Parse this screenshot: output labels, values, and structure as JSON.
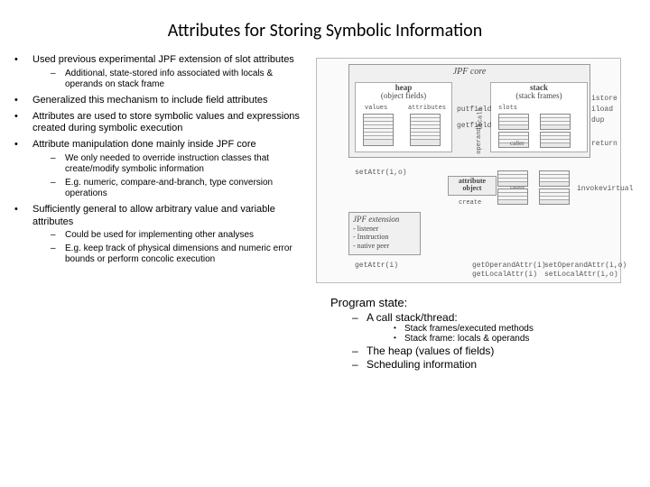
{
  "title": "Attributes for Storing Symbolic Information",
  "bullets": {
    "b1": "Used previous experimental JPF extension of slot attributes",
    "b1s1": "Additional, state-stored info associated with locals & operands on stack frame",
    "b2": "Generalized this mechanism to include field attributes",
    "b3": "Attributes are used to store symbolic values and expressions created during symbolic execution",
    "b4": "Attribute manipulation done mainly inside JPF core",
    "b4s1": "We only needed to override instruction classes that create/modify symbolic information",
    "b4s2": "E.g. numeric, compare-and-branch, type conversion operations",
    "b5": "Sufficiently general to allow arbitrary value and variable attributes",
    "b5s1": "Could be used for implementing other analyses",
    "b5s2": "E.g. keep track of physical dimensions and numeric error bounds or perform concolic execution"
  },
  "diagram": {
    "jpfcore": "JPF core",
    "heap_title": "heap",
    "heap_sub": "(object fields)",
    "stack_title": "stack",
    "stack_sub": "(stack frames)",
    "values": "values",
    "attributes": "attributes",
    "slots": "slots",
    "locals": "locals",
    "operands": "operands",
    "putfield": "putfield",
    "getfield": "getfield",
    "caller": "caller",
    "callee": "callee",
    "istore": "istore",
    "iload": "iload",
    "dup": "dup",
    "return": "return",
    "invokevirtual": "invokevirtual",
    "attr_obj1": "attribute",
    "attr_obj2": "object",
    "create": "create",
    "jpf_ext_head": "JPF extension",
    "jpf_ext1": "- listener",
    "jpf_ext2": "- Instruction",
    "jpf_ext3": "- native peer",
    "api_setAttr": "setAttr(i,o)",
    "api_getAttr": "getAttr(i)",
    "api_getOperandAttr": "getOperandAttr(i)",
    "api_getLocalAttr": "getLocalAttr(i)",
    "api_setOperandAttr": "setOperandAttr(i,o)",
    "api_setLocalAttr": "setLocalAttr(i,o)"
  },
  "program_state": {
    "title": "Program state:",
    "s1": "A call stack/thread:",
    "s1a": "Stack frames/executed methods",
    "s1b": "Stack frame: locals & operands",
    "s2": "The heap (values of fields)",
    "s3": "Scheduling information"
  }
}
